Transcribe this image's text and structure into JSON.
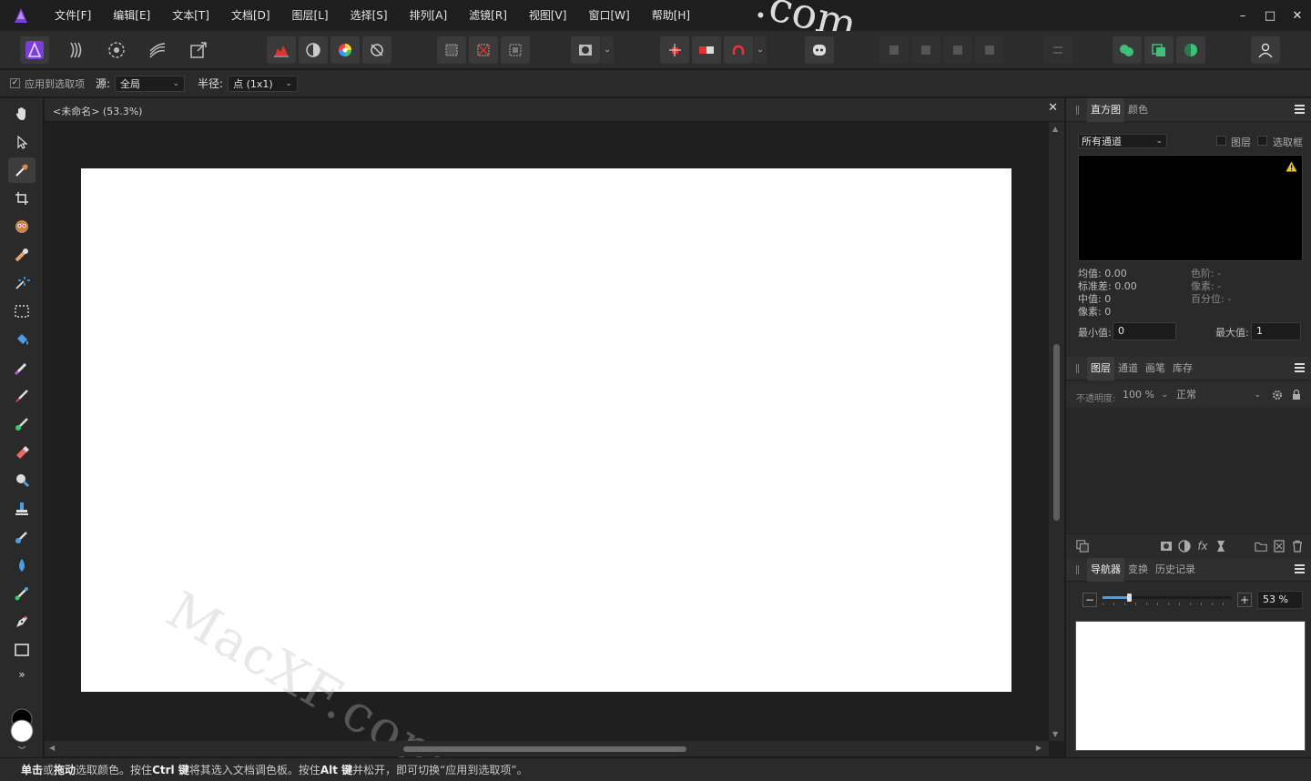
{
  "menu": [
    "文件[F]",
    "编辑[E]",
    "文本[T]",
    "文档[D]",
    "图层[L]",
    "选择[S]",
    "排列[A]",
    "滤镜[R]",
    "视图[V]",
    "窗口[W]",
    "帮助[H]"
  ],
  "window_controls": {
    "minimize": "–",
    "maximize": "□",
    "close": "✕"
  },
  "context": {
    "apply_to_selection": "应用到选取项",
    "source_label": "源:",
    "source_value": "全局",
    "radius_label": "半径:",
    "radius_value": "点 (1x1)"
  },
  "document": {
    "title": "<未命名> (53.3%)",
    "close": "✕"
  },
  "histogram_panel": {
    "tabs": [
      "直方图",
      "颜色"
    ],
    "channel_select": "所有通道",
    "layer_check_label": "图层",
    "marquee_check_label": "选取框",
    "mean": "均值: 0.00",
    "std_dev": "标准差: 0.00",
    "median": "中值: 0",
    "pixels": "像素: 0",
    "level": "色阶: -",
    "pixels_right": "像素: -",
    "percentile": "百分位: -",
    "min_label": "最小值:",
    "min_value": "0",
    "max_label": "最大值:",
    "max_value": "1"
  },
  "layers_panel": {
    "tabs": [
      "图层",
      "通道",
      "画笔",
      "库存"
    ],
    "opacity_label": "不透明度:",
    "opacity_value": "100 %",
    "blend_mode": "正常"
  },
  "navigator_panel": {
    "tabs": [
      "导航器",
      "变换",
      "历史记录"
    ],
    "zoom_value": "53 %",
    "zoom_level": 0.53
  },
  "status_bar": {
    "part1": "单击",
    "part2": " 或 ",
    "part3": "拖动",
    "part4": " 选取颜色。按住 ",
    "part5": "Ctrl 键",
    "part6": " 将其选入文档调色板。按住 ",
    "part7": "Alt 键",
    "part8": " 并松开，即可切换“应用到选取项”。"
  },
  "watermark": {
    "main": "MacXF.com",
    "top": ".com"
  },
  "colors": {
    "accent": "#7a3fd6",
    "canvas": "#ffffff",
    "panel_bg": "#2a2a2a",
    "app_bg": "#1e1e1e"
  }
}
